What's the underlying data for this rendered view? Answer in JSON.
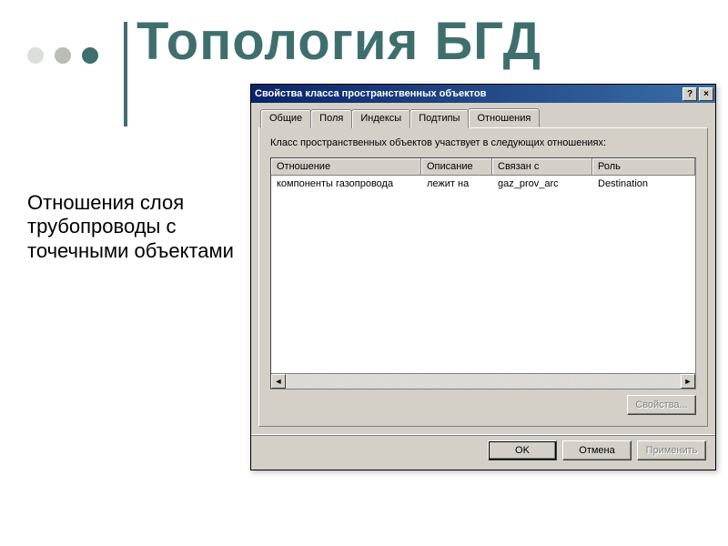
{
  "slide": {
    "title": "Топология БГД",
    "body": "Отношения слоя трубопроводы с точечными объектами"
  },
  "dialog": {
    "title": "Свойства класса пространственных объектов",
    "help_btn": "?",
    "close_btn": "×",
    "tabs": [
      "Общие",
      "Поля",
      "Индексы",
      "Подтипы",
      "Отношения"
    ],
    "active_tab": 4,
    "panel_text": "Класс пространственных объектов участвует в следующих отношениях:",
    "columns": [
      "Отношение",
      "Описание",
      "Связан с",
      "Роль"
    ],
    "rows": [
      {
        "rel": "компоненты газопровода",
        "desc": "лежит на",
        "link": "gaz_prov_arc",
        "role": "Destination"
      }
    ],
    "props_btn": "Свойства...",
    "buttons": {
      "ok": "OK",
      "cancel": "Отмена",
      "apply": "Применить"
    }
  }
}
